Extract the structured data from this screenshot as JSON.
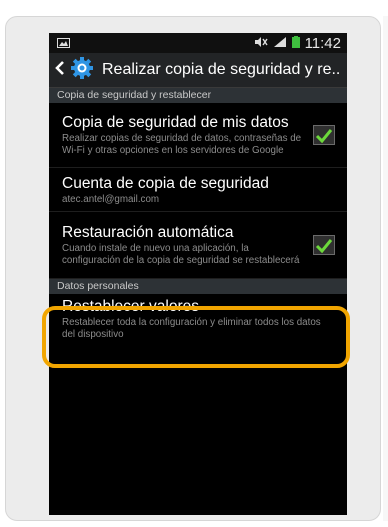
{
  "status_bar": {
    "time": "11:42",
    "icons": [
      "photo-notification-icon",
      "muted-icon",
      "signal-icon",
      "battery-icon"
    ]
  },
  "app_bar": {
    "title": "Realizar copia de seguridad y re..",
    "icons": [
      "back-icon",
      "settings-gear-icon"
    ]
  },
  "sections": [
    {
      "header": "Copia de seguridad y restablecer",
      "items": [
        {
          "title": "Copia de seguridad de mis datos",
          "subtitle": "Realizar copias de seguridad de datos, contraseñas de Wi-Fi y otras opciones en los servidores de Google",
          "checked": true
        },
        {
          "title": "Cuenta de copia de seguridad",
          "subtitle": "atec.antel@gmail.com"
        },
        {
          "title": "Restauración automática",
          "subtitle": "Cuando instale de nuevo una aplicación, la configuración de la copia de seguridad se restablecerá",
          "checked": true
        }
      ]
    },
    {
      "header": "Datos personales",
      "items": [
        {
          "title": "Restablecer valores",
          "subtitle": "Restablecer toda la configuración y eliminar todos los datos del dispositivo"
        }
      ]
    }
  ],
  "colors": {
    "highlight": "#f1a500",
    "checkmark": "#6cd83b",
    "gear_icon": "#2f95e4",
    "section_header_bg": "#2d3236"
  }
}
